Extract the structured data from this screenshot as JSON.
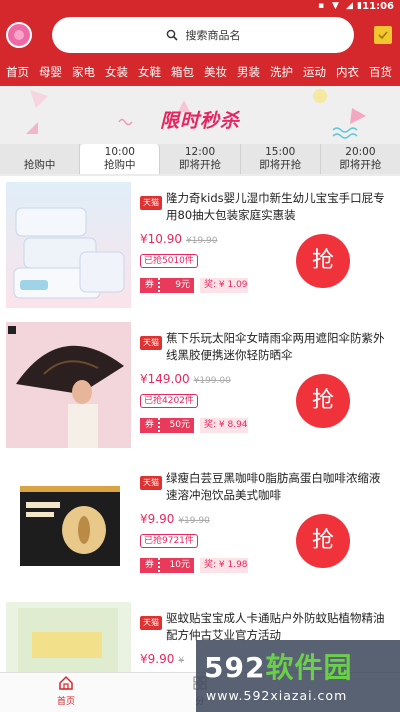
{
  "status": {
    "time": "11:06"
  },
  "header": {
    "search_placeholder": "搜索商品名"
  },
  "categories": [
    "首页",
    "母婴",
    "家电",
    "女装",
    "女鞋",
    "箱包",
    "美妆",
    "男装",
    "洗护",
    "运动",
    "内衣",
    "百货"
  ],
  "banner": {
    "title": "限时秒杀"
  },
  "time_slots": [
    {
      "time": "",
      "status": "抢购中"
    },
    {
      "time": "10:00",
      "status": "抢购中"
    },
    {
      "time": "12:00",
      "status": "即将开抢"
    },
    {
      "time": "15:00",
      "status": "即将开抢"
    },
    {
      "time": "20:00",
      "status": "即将开抢"
    }
  ],
  "products": [
    {
      "badge": "天猫",
      "title": "隆力奇kids婴儿湿巾新生幼儿宝宝手口屁专用80抽大包装家庭实惠装",
      "price": "¥10.90",
      "original": "¥19.90",
      "sold": "已抢5010件",
      "coupon_label": "券",
      "coupon": "9元",
      "reward": "奖: ¥ 1.09",
      "button": "抢"
    },
    {
      "badge": "天猫",
      "title": "蕉下乐玩太阳伞女晴雨伞两用遮阳伞防紫外线黑胶便携迷你轻防晒伞",
      "price": "¥149.00",
      "original": "¥199.00",
      "sold": "已抢4202件",
      "coupon_label": "券",
      "coupon": "50元",
      "reward": "奖: ¥ 8.94",
      "button": "抢"
    },
    {
      "badge": "天猫",
      "title": "绿瘦白芸豆黑咖啡0脂肪高蛋白咖啡浓缩液速溶冲泡饮品美式咖啡",
      "price": "¥9.90",
      "original": "¥19.90",
      "sold": "已抢9721件",
      "coupon_label": "券",
      "coupon": "10元",
      "reward": "奖: ¥ 1.98",
      "button": "抢"
    },
    {
      "badge": "天猫",
      "title": "驱蚊贴宝宝成人卡通贴户外防蚊贴植物精油配方仲古艾业官方活动",
      "price": "¥9.90",
      "original": "¥",
      "sold": "",
      "coupon_label": "",
      "coupon": "",
      "reward": "",
      "button": ""
    }
  ],
  "tabbar": {
    "home": "首页",
    "category": "分"
  },
  "watermark": {
    "line1_num": "592",
    "line1_text": "软件园",
    "line2": "www.592xiazai.com"
  },
  "colors": {
    "brand": "#d4282d",
    "price": "#e8285e",
    "button": "#f0323b"
  }
}
